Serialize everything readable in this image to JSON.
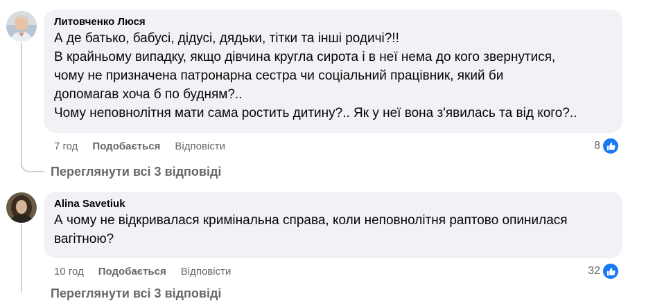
{
  "comments": [
    {
      "author": "Литовченко Люся",
      "lines": [
        "А де батько, бабусі, дідусі, дядьки, тітки та інші родичі?!!",
        "В крайньому випадку, якщо дівчина кругла сирота і в неї нема до кого звернутися,",
        "чому не призначена патронарна сестра чи соціальний працівник, який би",
        "допомагав хоча б по будням?..",
        "Чому неповнолітня мати сама ростить дитину?.. Як у неї вона з'явилась та від кого?.."
      ],
      "time": "7 год",
      "like_label": "Подобається",
      "reply_label": "Відповісти",
      "reaction_count": "8",
      "reaction_icon": "like-icon",
      "view_replies": "Переглянути всі 3 відповіді"
    },
    {
      "author": "Alina Savetiuk",
      "lines": [
        "А чому не відкривалася кримінальна справа, коли неповнолітня раптово опинилася",
        "вагітною?"
      ],
      "time": "10 год",
      "like_label": "Подобається",
      "reply_label": "Відповісти",
      "reaction_count": "32",
      "reaction_icon": "like-icon",
      "view_replies": "Переглянути всі 3 відповіді"
    }
  ],
  "colors": {
    "bubble": "#f0f2f5",
    "meta_text": "#65676b",
    "like_blue": "#1877f2",
    "thread_line": "#ced0d4"
  }
}
